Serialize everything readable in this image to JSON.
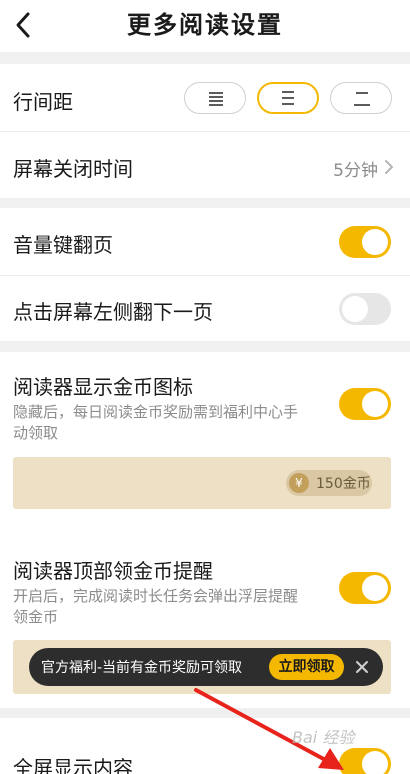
{
  "header": {
    "title": "更多阅读设置",
    "back_icon": "chevron-left-icon"
  },
  "line_spacing": {
    "label": "行间距",
    "options": [
      {
        "icon": "spacing-small-icon"
      },
      {
        "icon": "spacing-medium-icon",
        "selected": true
      },
      {
        "icon": "spacing-large-icon"
      }
    ]
  },
  "screen_timeout": {
    "label": "屏幕关闭时间",
    "value": "5分钟"
  },
  "volume_flip": {
    "label": "音量键翻页",
    "on": true
  },
  "tap_left_next": {
    "label": "点击屏幕左侧翻下一页",
    "on": false
  },
  "coin_icon_setting": {
    "label": "阅读器显示金币图标",
    "on": true,
    "description_line1": "隐藏后，每日阅读金币奖励需到福利中心手",
    "description_line2": "动领取",
    "preview_badge_glyph": "¥",
    "preview_badge": "150金币"
  },
  "top_coin_reminder": {
    "label": "阅读器顶部领金币提醒",
    "on": true,
    "description_line1": "开启后，完成阅读时长任务会弹出浮层提醒",
    "description_line2": "领金币",
    "banner_text": "官方福利-当前有金币奖励可领取",
    "banner_button": "立即领取",
    "close_icon": "close-icon"
  },
  "fullscreen": {
    "label": "全屏显示内容",
    "on": true
  },
  "watermark": "Bai 经验",
  "colors": {
    "accent": "#f5b800",
    "arrow": "#e8231c",
    "preview_bg": "#ede0c4"
  }
}
